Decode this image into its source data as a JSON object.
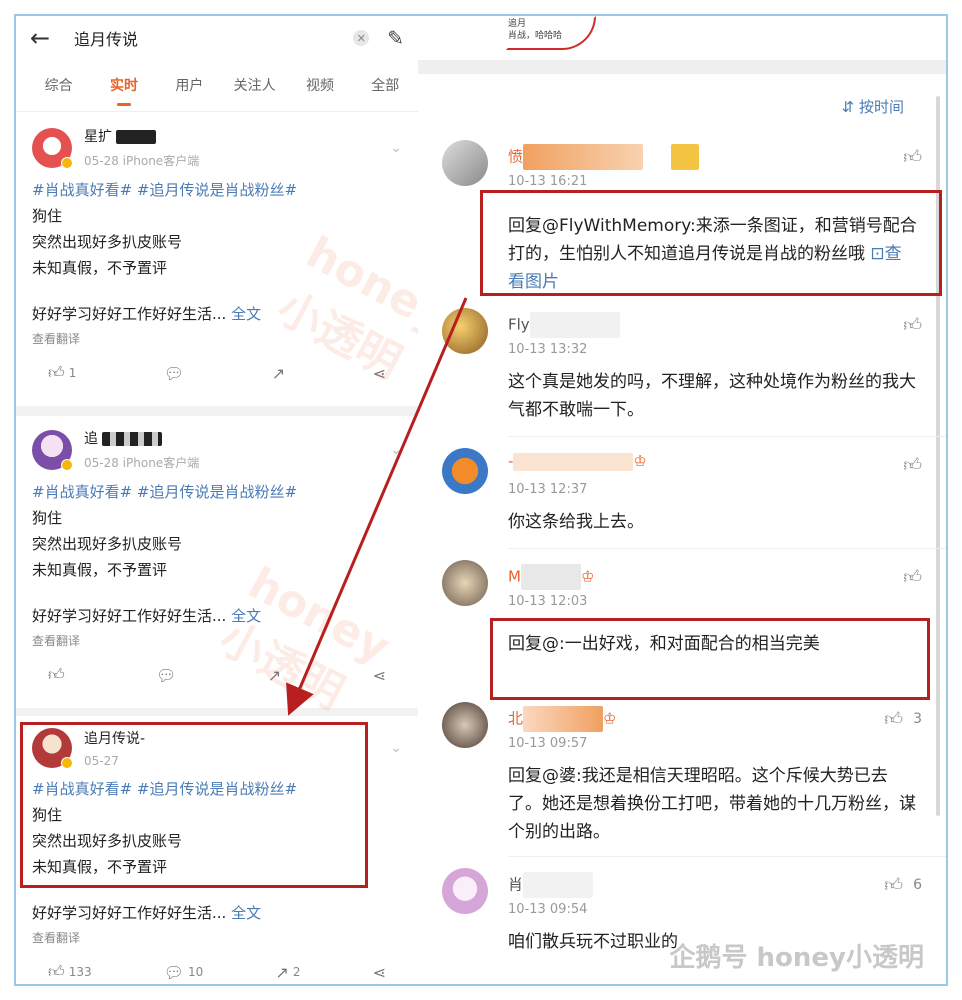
{
  "search": {
    "query": "追月传说"
  },
  "tabs": [
    "综合",
    "实时",
    "用户",
    "关注人",
    "视频",
    "全部"
  ],
  "posts": [
    {
      "name": "星扩",
      "meta": "05-28  iPhone客户端",
      "hashtags": "#肖战真好看# #追月传说是肖战粉丝#",
      "lines": [
        "狗住",
        "突然出现好多扒皮账号",
        "未知真假，不予置评"
      ],
      "more": "好好学习好好工作好好生活...",
      "more_link": "全文",
      "translate": "查看翻译",
      "likes": "1"
    },
    {
      "name": "追",
      "meta": "05-28  iPhone客户端",
      "hashtags": "#肖战真好看# #追月传说是肖战粉丝#",
      "lines": [
        "狗住",
        "突然出现好多扒皮账号",
        "未知真假，不予置评"
      ],
      "more": "好好学习好好工作好好生活...",
      "more_link": "全文",
      "translate": "查看翻译",
      "likes": ""
    },
    {
      "name": "追月传说-",
      "meta": "05-27",
      "hashtags": "#肖战真好看# #追月传说是肖战粉丝#",
      "lines": [
        "狗住",
        "突然出现好多扒皮账号",
        "未知真假，不予置评"
      ],
      "more": "好好学习好好工作好好生活...",
      "more_link": "全文",
      "translate": "查看翻译",
      "likes": "133",
      "comments": "10",
      "shares": "2"
    }
  ],
  "thumb": {
    "line1": "追月",
    "line2": "肖战，哈哈哈"
  },
  "sort_label": "按时间",
  "comments": [
    {
      "name": "愤",
      "time": "10-13 16:21",
      "text": "回复@FlyWithMemory:来添一条图证，和营销号配合打的，生怕别人不知道追月传说是肖战的粉丝哦",
      "link": "查看图片",
      "likes": ""
    },
    {
      "name": "Fly",
      "time": "10-13 13:32",
      "text": "这个真是她发的吗，不理解，这种处境作为粉丝的我大气都不敢喘一下。",
      "likes": ""
    },
    {
      "name": "-",
      "time": "10-13 12:37",
      "text": "你这条给我上去。",
      "likes": ""
    },
    {
      "name": "M",
      "time": "10-13 12:03",
      "text": "回复@:一出好戏，和对面配合的相当完美",
      "likes": ""
    },
    {
      "name": "北",
      "time": "10-13 09:57",
      "text": "回复@婆:我还是相信天理昭昭。这个斥候大势已去了。她还是想着换份工打吧，带着她的十几万粉丝，谋个别的出路。",
      "likes": "3"
    },
    {
      "name": "肖",
      "time": "10-13 09:54",
      "text": "咱们散兵玩不过职业的",
      "likes": "6"
    }
  ],
  "watermark": "honey小透明",
  "footer_mark": "企鹅号 honey小透明",
  "colors": {
    "accent": "#e8632b",
    "link": "#4a7bb5",
    "highlight": "#b81f1f"
  }
}
